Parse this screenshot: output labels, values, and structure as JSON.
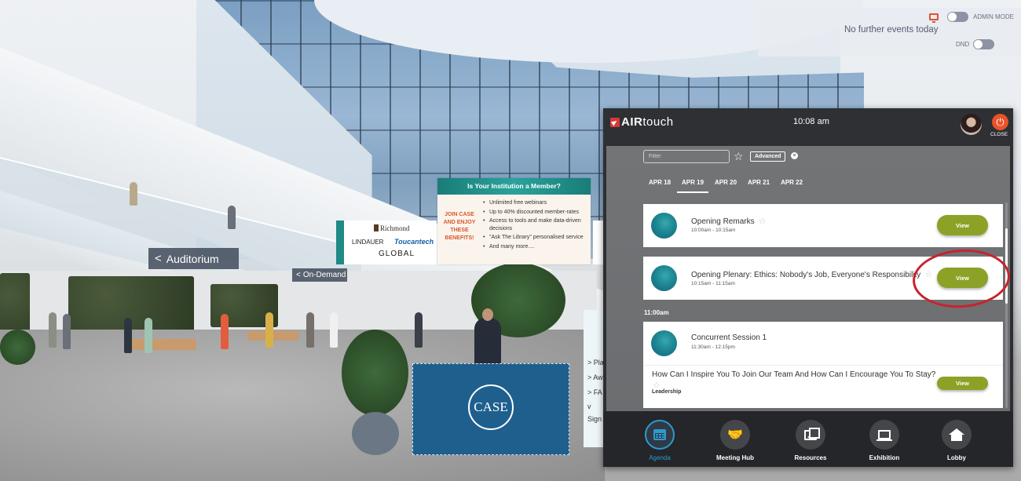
{
  "scene": {
    "signs": {
      "auditorium": "Auditorium",
      "on_demand": "On-Demand",
      "chevron": "<"
    },
    "sponsor_banner": {
      "sponsors": [
        "Richmond",
        "LINDAUER",
        "Toucantech",
        "GLOBAL"
      ]
    },
    "member_banner": {
      "title": "Is Your Institution a Member?",
      "callout": "JOIN CASE AND ENJOY THESE BENEFITS!",
      "benefits": [
        "Unlimited free webinars",
        "Up to 40% discounted member-rates",
        "Access to tools and make data-driven decisions",
        "\"Ask The Library\" personalised service",
        "And many more...."
      ]
    },
    "desk": {
      "logo": "CASE"
    },
    "side_panel": {
      "items": [
        "> Pla",
        "> Aw",
        "> FA",
        "v",
        "Sign"
      ]
    }
  },
  "notification_panel": {
    "message": "No further events today",
    "admin_mode_label": "ADMIN MODE",
    "admin_mode_on": false,
    "dnd_label": "DND",
    "dnd_on": false
  },
  "app": {
    "brand_bold": "AIR",
    "brand_light": "touch",
    "time": "10:08 am",
    "close_label": "CLOSE",
    "filter": {
      "placeholder": "Filter",
      "value": ""
    },
    "advanced_label": "Advanced",
    "clear_symbol": "×",
    "favorite_symbol": "☆",
    "date_tabs": [
      {
        "label": "APR 18",
        "active": false
      },
      {
        "label": "APR 19",
        "active": true
      },
      {
        "label": "APR 20",
        "active": false
      },
      {
        "label": "APR 21",
        "active": false
      },
      {
        "label": "APR 22",
        "active": false
      }
    ],
    "sessions": [
      {
        "title": "Opening Remarks",
        "time": "10:00am - 10:15am",
        "button": "View"
      },
      {
        "title": "Opening Plenary: Ethics: Nobody's Job, Everyone's Responsibility",
        "time": "10:15am - 11:15am",
        "button": "View"
      }
    ],
    "time_group": "11:00am",
    "concurrent": {
      "title": "Concurrent Session 1",
      "time": "11:30am - 12:15pm",
      "subsession": {
        "title": "How Can I Inspire You To Join Our Team And How Can I Encourage You To Stay?",
        "tag": "Leadership",
        "button": "View"
      }
    },
    "nav": [
      {
        "label": "Agenda",
        "icon": "calendar-icon",
        "active": true
      },
      {
        "label": "Meeting Hub",
        "icon": "handshake-icon",
        "active": false
      },
      {
        "label": "Resources",
        "icon": "media-icon",
        "active": false
      },
      {
        "label": "Exhibition",
        "icon": "screen-icon",
        "active": false
      },
      {
        "label": "Lobby",
        "icon": "home-icon",
        "active": false
      }
    ],
    "colors": {
      "accent_blue": "#2e9ad1",
      "view_green": "#8ba226",
      "close_orange": "#e8532a",
      "brand_red": "#d8383a",
      "highlight_red": "#c8232c"
    }
  }
}
